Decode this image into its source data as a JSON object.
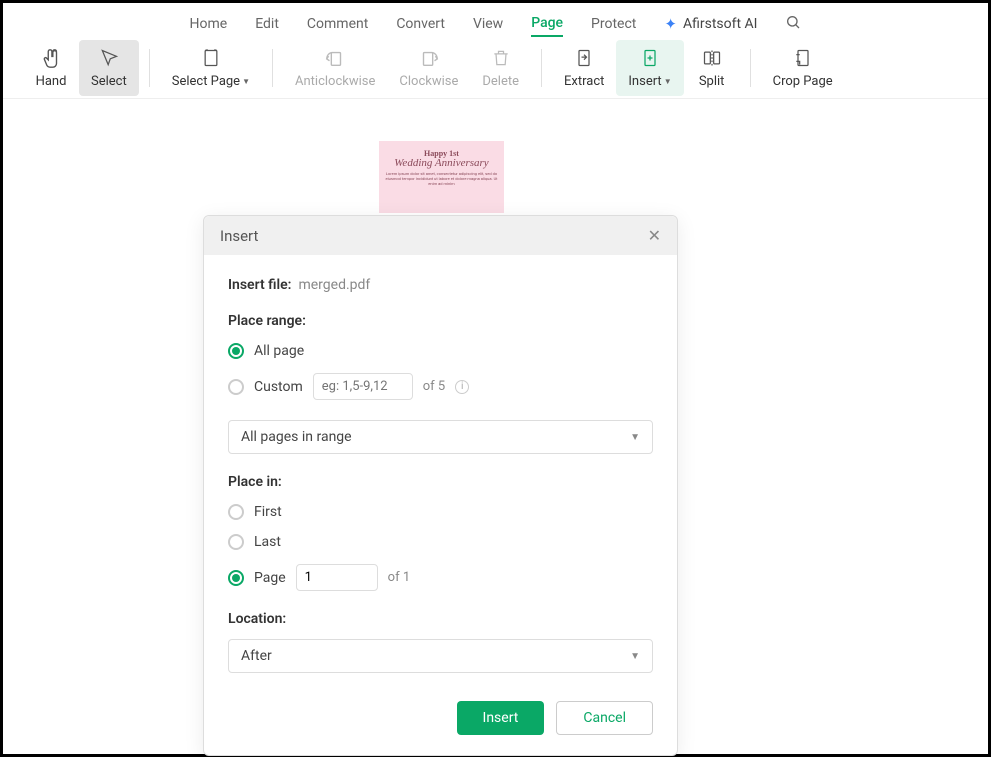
{
  "menu": {
    "home": "Home",
    "edit": "Edit",
    "comment": "Comment",
    "convert": "Convert",
    "view": "View",
    "page": "Page",
    "protect": "Protect",
    "ai": "Afirstsoft AI"
  },
  "toolbar": {
    "hand": "Hand",
    "select": "Select",
    "select_page": "Select Page",
    "anticlockwise": "Anticlockwise",
    "clockwise": "Clockwise",
    "delete": "Delete",
    "extract": "Extract",
    "insert": "Insert",
    "split": "Split",
    "crop_page": "Crop Page"
  },
  "thumb": {
    "line1": "Happy 1st",
    "line2": "Wedding Anniversary",
    "line3": "Lorem ipsum dolor sit amet, consectetur adipiscing elit, sed do eiusmod tempor incididunt ut labore et dolore magna aliqua. Ut enim ad minim"
  },
  "dialog": {
    "title": "Insert",
    "insert_file_label": "Insert file:",
    "insert_file_name": "merged.pdf",
    "place_range_label": "Place range:",
    "all_page": "All page",
    "custom": "Custom",
    "custom_placeholder": "eg: 1,5-9,12",
    "of_total": "of 5",
    "range_dropdown": "All pages in range",
    "place_in_label": "Place in:",
    "first": "First",
    "last": "Last",
    "page": "Page",
    "page_value": "1",
    "of_pages": "of 1",
    "location_label": "Location:",
    "location_dropdown": "After",
    "insert_btn": "Insert",
    "cancel_btn": "Cancel"
  }
}
